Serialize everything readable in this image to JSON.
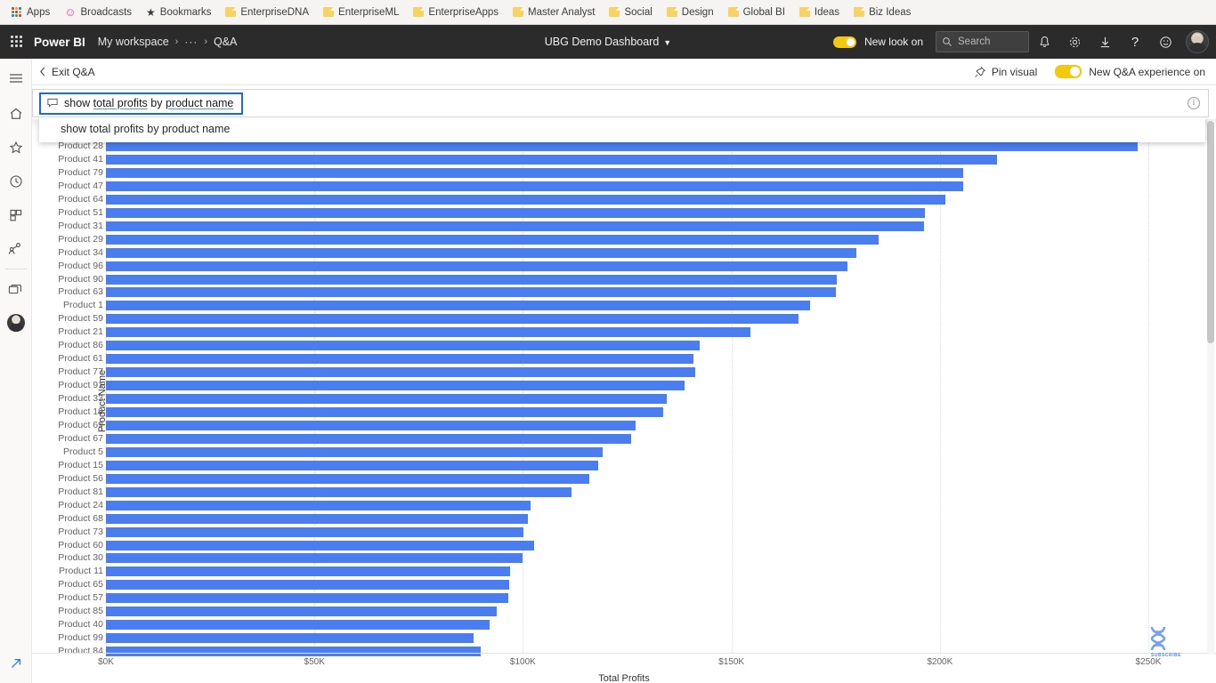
{
  "browser": {
    "bookmarks": [
      {
        "label": "Apps",
        "icon": "apps-grid-icon"
      },
      {
        "label": "Broadcasts",
        "icon": "smiley-icon"
      },
      {
        "label": "Bookmarks",
        "icon": "star-icon"
      },
      {
        "label": "EnterpriseDNA",
        "icon": "folder-icon"
      },
      {
        "label": "EnterpriseML",
        "icon": "folder-icon"
      },
      {
        "label": "EnterpriseApps",
        "icon": "folder-icon"
      },
      {
        "label": "Master Analyst",
        "icon": "folder-icon"
      },
      {
        "label": "Social",
        "icon": "folder-icon"
      },
      {
        "label": "Design",
        "icon": "folder-icon"
      },
      {
        "label": "Global BI",
        "icon": "folder-icon"
      },
      {
        "label": "Ideas",
        "icon": "folder-icon"
      },
      {
        "label": "Biz Ideas",
        "icon": "folder-icon"
      }
    ]
  },
  "topnav": {
    "brand": "Power BI",
    "breadcrumb": {
      "workspace": "My workspace",
      "ellipsis": "···",
      "current": "Q&A",
      "separator": "›"
    },
    "dashboard_title": "UBG Demo Dashboard",
    "new_look_label": "New look on",
    "new_look_on": true,
    "search_placeholder": "Search",
    "icons": [
      "notifications-bell-icon",
      "settings-gear-icon",
      "download-icon",
      "help-question-icon",
      "feedback-smiley-icon",
      "user-avatar"
    ],
    "accent_color": "#f2c811",
    "bar_color": "#2b2b2b"
  },
  "qabar": {
    "exit_label": "Exit Q&A",
    "pin_visual_label": "Pin visual",
    "new_experience_label": "New Q&A experience on",
    "new_experience_on": true
  },
  "qainput": {
    "chip_prefix": "show ",
    "term_one": "total profits",
    "chip_middle": " by ",
    "term_two": "product name",
    "full_query": "show total profits by product name",
    "suggestion": "show total profits by product name",
    "focus_border_color": "#1a6cd4",
    "info_icon": "info-circle-icon"
  },
  "rail": {
    "items": [
      {
        "name": "hamburger-menu-icon"
      },
      {
        "name": "home-icon"
      },
      {
        "name": "favorites-star-icon"
      },
      {
        "name": "recent-clock-icon"
      },
      {
        "name": "apps-icon"
      },
      {
        "name": "shared-with-me-icon"
      },
      {
        "name": "workspaces-icon"
      },
      {
        "name": "my-workspace-avatar"
      },
      {
        "name": "expand-arrow-icon"
      }
    ]
  },
  "watermark": {
    "label": "SUBSCRIBE",
    "icon": "dna-helix-icon",
    "color": "#4a7ef0"
  },
  "chart_data": {
    "type": "bar",
    "orientation": "horizontal",
    "title": "",
    "xlabel": "Total Profits",
    "ylabel": "Product Name",
    "xlim": [
      0,
      250000
    ],
    "xticks": [
      0,
      50000,
      100000,
      150000,
      200000,
      250000
    ],
    "xticklabels": [
      "$0K",
      "$50K",
      "$100K",
      "$150K",
      "$200K",
      "$250K"
    ],
    "grid": true,
    "legend": false,
    "bar_color": "#4a7ef0",
    "categories": [
      "Product 28",
      "Product 41",
      "Product 79",
      "Product 47",
      "Product 64",
      "Product 51",
      "Product 31",
      "Product 29",
      "Product 34",
      "Product 96",
      "Product 90",
      "Product 63",
      "Product 1",
      "Product 59",
      "Product 21",
      "Product 86",
      "Product 61",
      "Product 77",
      "Product 91",
      "Product 33",
      "Product 19",
      "Product 69",
      "Product 67",
      "Product 5",
      "Product 15",
      "Product 56",
      "Product 81",
      "Product 24",
      "Product 68",
      "Product 73",
      "Product 60",
      "Product 30",
      "Product 11",
      "Product 65",
      "Product 57",
      "Product 85",
      "Product 40",
      "Product 99",
      "Product 84"
    ],
    "values": [
      247500,
      213700,
      205700,
      205500,
      201300,
      196500,
      196300,
      185300,
      180000,
      177900,
      175200,
      175100,
      168900,
      166000,
      154600,
      142500,
      141000,
      141400,
      138800,
      134400,
      133700,
      127100,
      126000,
      119100,
      118000,
      116000,
      111700,
      101900,
      101200,
      100200,
      102700,
      100000,
      97000,
      96800,
      96500,
      93700,
      92000,
      88200,
      89900
    ]
  }
}
